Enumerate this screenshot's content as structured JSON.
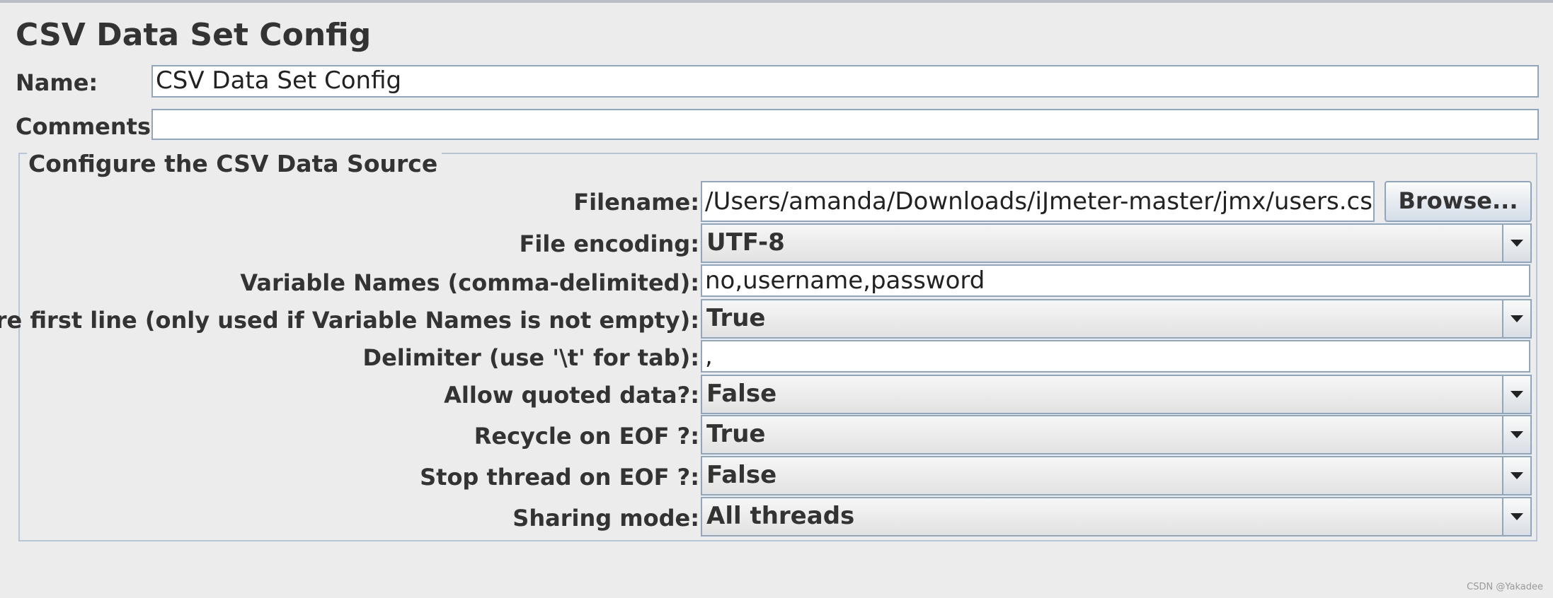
{
  "panel": {
    "title": "CSV Data Set Config",
    "name_label": "Name:",
    "name_value": "CSV Data Set Config",
    "comments_label": "Comments:",
    "comments_value": ""
  },
  "group": {
    "legend": "Configure the CSV Data Source",
    "filename": {
      "label": "Filename:",
      "value": "/Users/amanda/Downloads/iJmeter-master/jmx/users.csv",
      "browse_label": "Browse..."
    },
    "file_encoding": {
      "label": "File encoding:",
      "value": "UTF-8"
    },
    "variable_names": {
      "label": "Variable Names (comma-delimited):",
      "value": "no,username,password"
    },
    "ignore_first_line": {
      "label": "Ignore first line (only used if Variable Names is not empty):",
      "value": "True"
    },
    "delimiter": {
      "label": "Delimiter (use '\\t' for tab):",
      "value": ","
    },
    "allow_quoted": {
      "label": "Allow quoted data?:",
      "value": "False"
    },
    "recycle_eof": {
      "label": "Recycle on EOF ?:",
      "value": "True"
    },
    "stop_thread_eof": {
      "label": "Stop thread on EOF ?:",
      "value": "False"
    },
    "sharing_mode": {
      "label": "Sharing mode:",
      "value": "All threads"
    }
  },
  "watermark": "CSDN @Yakadee"
}
